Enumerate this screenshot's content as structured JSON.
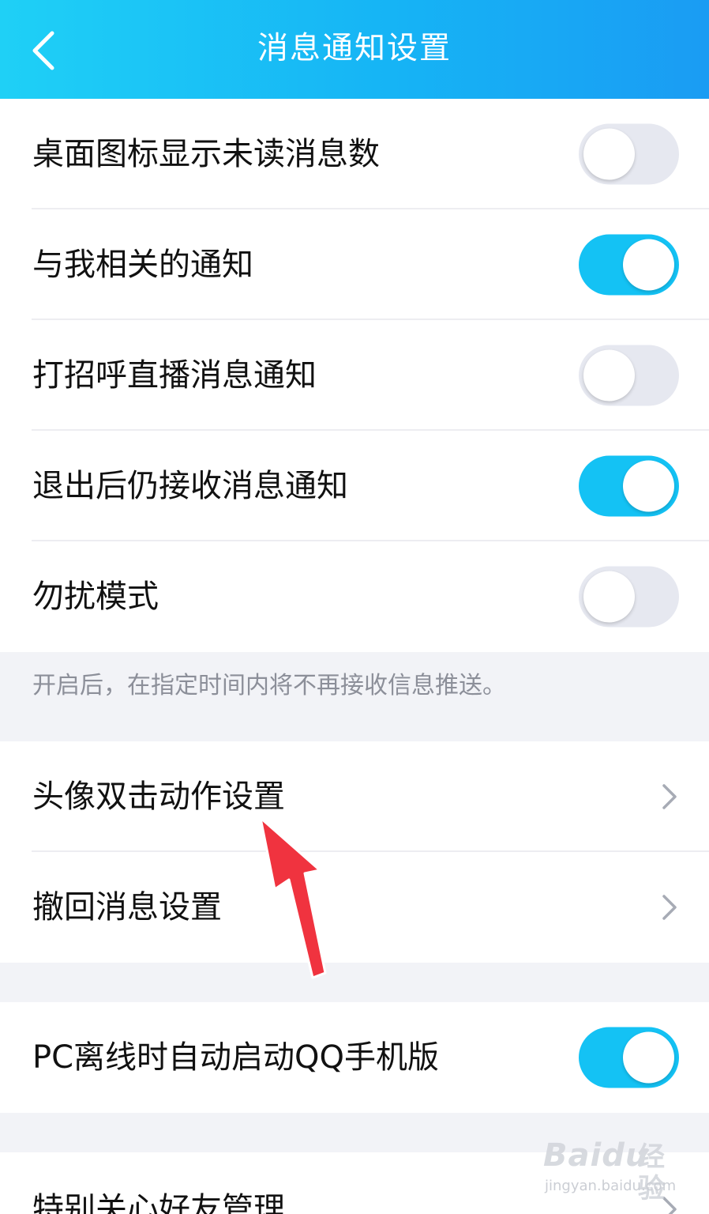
{
  "header": {
    "title": "消息通知设置",
    "back_icon": "chevron-left-icon"
  },
  "section1": {
    "items": [
      {
        "label": "桌面图标显示未读消息数",
        "toggle": "off"
      },
      {
        "label": "与我相关的通知",
        "toggle": "on"
      },
      {
        "label": "打招呼直播消息通知",
        "toggle": "off"
      },
      {
        "label": "退出后仍接收消息通知",
        "toggle": "on"
      },
      {
        "label": "勿扰模式",
        "toggle": "off"
      }
    ],
    "note": "开启后，在指定时间内将不再接收信息推送。"
  },
  "section2": {
    "items": [
      {
        "label": "头像双击动作设置",
        "icon": "chevron-right-icon"
      },
      {
        "label": "撤回消息设置",
        "icon": "chevron-right-icon"
      }
    ]
  },
  "section3": {
    "items": [
      {
        "label": "PC离线时自动启动QQ手机版",
        "toggle": "on"
      }
    ]
  },
  "section4": {
    "items": [
      {
        "label": "特别关心好友管理",
        "icon": "chevron-right-icon"
      }
    ]
  },
  "colors": {
    "header_start": "#1fd0f6",
    "header_end": "#1a9cf3",
    "toggle_on": "#14c2f4",
    "toggle_off": "#e6e8f0",
    "page_bg": "#f2f3f7",
    "annotation_arrow": "#f0333f"
  },
  "watermark": {
    "logo": "Baidu",
    "cn": "经验",
    "url": "jingyan.baidu.com"
  }
}
